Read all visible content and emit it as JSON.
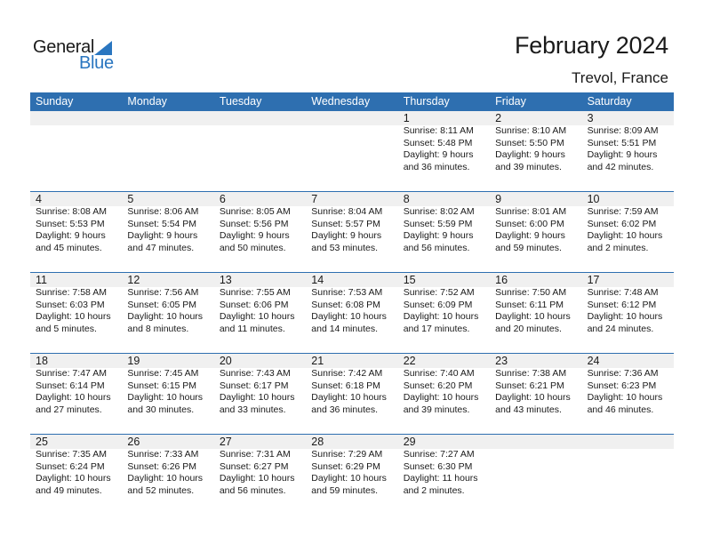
{
  "logo": {
    "word1": "General",
    "word2": "Blue",
    "icon": "triangle-logo-icon",
    "accent_color": "#2a76c0"
  },
  "header": {
    "title": "February 2024",
    "location": "Trevol, France"
  },
  "theme": {
    "header_bg": "#2e6fb0",
    "date_strip_bg": "#f0f0f0"
  },
  "weekdays": [
    "Sunday",
    "Monday",
    "Tuesday",
    "Wednesday",
    "Thursday",
    "Friday",
    "Saturday"
  ],
  "weeks": [
    [
      null,
      null,
      null,
      null,
      {
        "day": "1",
        "sunrise": "Sunrise: 8:11 AM",
        "sunset": "Sunset: 5:48 PM",
        "daylight1": "Daylight: 9 hours",
        "daylight2": "and 36 minutes."
      },
      {
        "day": "2",
        "sunrise": "Sunrise: 8:10 AM",
        "sunset": "Sunset: 5:50 PM",
        "daylight1": "Daylight: 9 hours",
        "daylight2": "and 39 minutes."
      },
      {
        "day": "3",
        "sunrise": "Sunrise: 8:09 AM",
        "sunset": "Sunset: 5:51 PM",
        "daylight1": "Daylight: 9 hours",
        "daylight2": "and 42 minutes."
      }
    ],
    [
      {
        "day": "4",
        "sunrise": "Sunrise: 8:08 AM",
        "sunset": "Sunset: 5:53 PM",
        "daylight1": "Daylight: 9 hours",
        "daylight2": "and 45 minutes."
      },
      {
        "day": "5",
        "sunrise": "Sunrise: 8:06 AM",
        "sunset": "Sunset: 5:54 PM",
        "daylight1": "Daylight: 9 hours",
        "daylight2": "and 47 minutes."
      },
      {
        "day": "6",
        "sunrise": "Sunrise: 8:05 AM",
        "sunset": "Sunset: 5:56 PM",
        "daylight1": "Daylight: 9 hours",
        "daylight2": "and 50 minutes."
      },
      {
        "day": "7",
        "sunrise": "Sunrise: 8:04 AM",
        "sunset": "Sunset: 5:57 PM",
        "daylight1": "Daylight: 9 hours",
        "daylight2": "and 53 minutes."
      },
      {
        "day": "8",
        "sunrise": "Sunrise: 8:02 AM",
        "sunset": "Sunset: 5:59 PM",
        "daylight1": "Daylight: 9 hours",
        "daylight2": "and 56 minutes."
      },
      {
        "day": "9",
        "sunrise": "Sunrise: 8:01 AM",
        "sunset": "Sunset: 6:00 PM",
        "daylight1": "Daylight: 9 hours",
        "daylight2": "and 59 minutes."
      },
      {
        "day": "10",
        "sunrise": "Sunrise: 7:59 AM",
        "sunset": "Sunset: 6:02 PM",
        "daylight1": "Daylight: 10 hours",
        "daylight2": "and 2 minutes."
      }
    ],
    [
      {
        "day": "11",
        "sunrise": "Sunrise: 7:58 AM",
        "sunset": "Sunset: 6:03 PM",
        "daylight1": "Daylight: 10 hours",
        "daylight2": "and 5 minutes."
      },
      {
        "day": "12",
        "sunrise": "Sunrise: 7:56 AM",
        "sunset": "Sunset: 6:05 PM",
        "daylight1": "Daylight: 10 hours",
        "daylight2": "and 8 minutes."
      },
      {
        "day": "13",
        "sunrise": "Sunrise: 7:55 AM",
        "sunset": "Sunset: 6:06 PM",
        "daylight1": "Daylight: 10 hours",
        "daylight2": "and 11 minutes."
      },
      {
        "day": "14",
        "sunrise": "Sunrise: 7:53 AM",
        "sunset": "Sunset: 6:08 PM",
        "daylight1": "Daylight: 10 hours",
        "daylight2": "and 14 minutes."
      },
      {
        "day": "15",
        "sunrise": "Sunrise: 7:52 AM",
        "sunset": "Sunset: 6:09 PM",
        "daylight1": "Daylight: 10 hours",
        "daylight2": "and 17 minutes."
      },
      {
        "day": "16",
        "sunrise": "Sunrise: 7:50 AM",
        "sunset": "Sunset: 6:11 PM",
        "daylight1": "Daylight: 10 hours",
        "daylight2": "and 20 minutes."
      },
      {
        "day": "17",
        "sunrise": "Sunrise: 7:48 AM",
        "sunset": "Sunset: 6:12 PM",
        "daylight1": "Daylight: 10 hours",
        "daylight2": "and 24 minutes."
      }
    ],
    [
      {
        "day": "18",
        "sunrise": "Sunrise: 7:47 AM",
        "sunset": "Sunset: 6:14 PM",
        "daylight1": "Daylight: 10 hours",
        "daylight2": "and 27 minutes."
      },
      {
        "day": "19",
        "sunrise": "Sunrise: 7:45 AM",
        "sunset": "Sunset: 6:15 PM",
        "daylight1": "Daylight: 10 hours",
        "daylight2": "and 30 minutes."
      },
      {
        "day": "20",
        "sunrise": "Sunrise: 7:43 AM",
        "sunset": "Sunset: 6:17 PM",
        "daylight1": "Daylight: 10 hours",
        "daylight2": "and 33 minutes."
      },
      {
        "day": "21",
        "sunrise": "Sunrise: 7:42 AM",
        "sunset": "Sunset: 6:18 PM",
        "daylight1": "Daylight: 10 hours",
        "daylight2": "and 36 minutes."
      },
      {
        "day": "22",
        "sunrise": "Sunrise: 7:40 AM",
        "sunset": "Sunset: 6:20 PM",
        "daylight1": "Daylight: 10 hours",
        "daylight2": "and 39 minutes."
      },
      {
        "day": "23",
        "sunrise": "Sunrise: 7:38 AM",
        "sunset": "Sunset: 6:21 PM",
        "daylight1": "Daylight: 10 hours",
        "daylight2": "and 43 minutes."
      },
      {
        "day": "24",
        "sunrise": "Sunrise: 7:36 AM",
        "sunset": "Sunset: 6:23 PM",
        "daylight1": "Daylight: 10 hours",
        "daylight2": "and 46 minutes."
      }
    ],
    [
      {
        "day": "25",
        "sunrise": "Sunrise: 7:35 AM",
        "sunset": "Sunset: 6:24 PM",
        "daylight1": "Daylight: 10 hours",
        "daylight2": "and 49 minutes."
      },
      {
        "day": "26",
        "sunrise": "Sunrise: 7:33 AM",
        "sunset": "Sunset: 6:26 PM",
        "daylight1": "Daylight: 10 hours",
        "daylight2": "and 52 minutes."
      },
      {
        "day": "27",
        "sunrise": "Sunrise: 7:31 AM",
        "sunset": "Sunset: 6:27 PM",
        "daylight1": "Daylight: 10 hours",
        "daylight2": "and 56 minutes."
      },
      {
        "day": "28",
        "sunrise": "Sunrise: 7:29 AM",
        "sunset": "Sunset: 6:29 PM",
        "daylight1": "Daylight: 10 hours",
        "daylight2": "and 59 minutes."
      },
      {
        "day": "29",
        "sunrise": "Sunrise: 7:27 AM",
        "sunset": "Sunset: 6:30 PM",
        "daylight1": "Daylight: 11 hours",
        "daylight2": "and 2 minutes."
      },
      null,
      null
    ]
  ]
}
